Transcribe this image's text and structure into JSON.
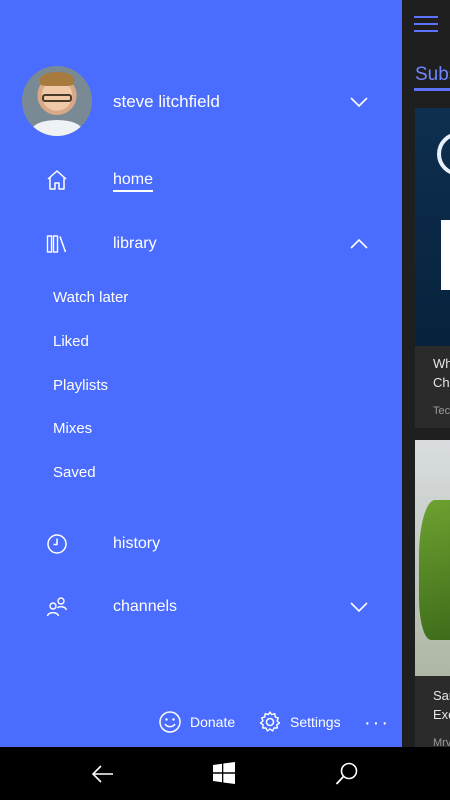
{
  "content_pane": {
    "tab_label": "Subs",
    "cards": [
      {
        "title_line1": "Wh",
        "title_line2": "Chr",
        "channel": "Tec"
      },
      {
        "title_line1": "Sar",
        "title_line2": "Exc",
        "channel": "Mrv"
      }
    ]
  },
  "profile": {
    "name": "steve litchfield"
  },
  "nav": {
    "home": "home",
    "library": "library",
    "library_items": [
      "Watch later",
      "Liked",
      "Playlists",
      "Mixes",
      "Saved"
    ],
    "history": "history",
    "channels": "channels"
  },
  "footer": {
    "donate": "Donate",
    "settings": "Settings",
    "more": "···"
  },
  "colors": {
    "nav_background": "#4a6cff",
    "accent": "#5b73ff",
    "content_background": "#1f1f1f"
  },
  "icons": {
    "menu": "hamburger-icon",
    "profile_expand": "chevron-down-icon",
    "home": "home-icon",
    "library": "library-icon",
    "library_collapse": "chevron-up-icon",
    "history": "clock-icon",
    "channels": "people-icon",
    "channels_expand": "chevron-down-icon",
    "donate": "smiley-icon",
    "settings": "gear-icon",
    "back": "back-arrow-icon",
    "start": "windows-icon",
    "search": "search-icon"
  }
}
